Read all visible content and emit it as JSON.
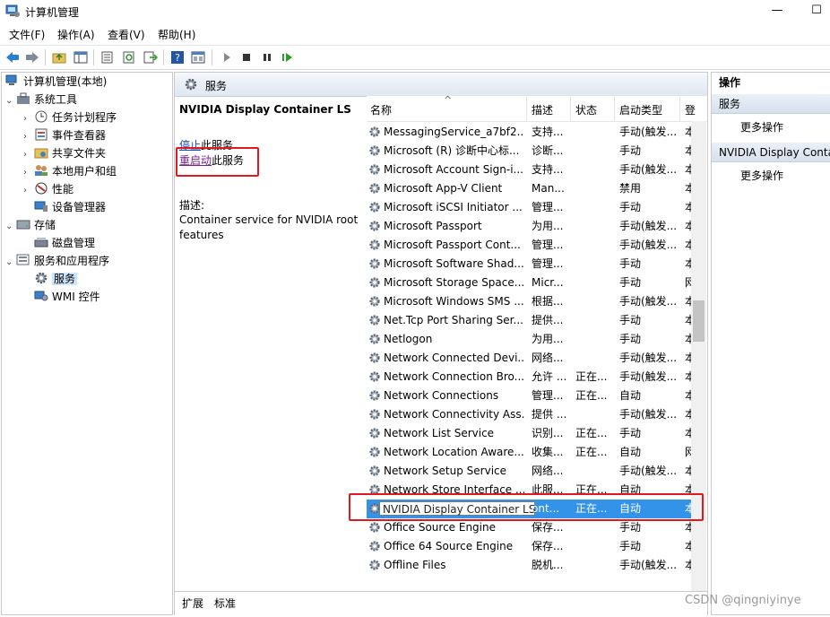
{
  "window": {
    "title": "计算机管理",
    "minimize_glyph": "—",
    "maximize_glyph": "☐"
  },
  "menu": [
    "文件(F)",
    "操作(A)",
    "查看(V)",
    "帮助(H)"
  ],
  "toolbar_icons": [
    "back-icon",
    "forward-icon",
    "up-folder-icon",
    "show-tree-icon",
    "properties-icon",
    "refresh-icon",
    "export-icon",
    "help-icon",
    "console-icon",
    "play-icon",
    "stop-icon",
    "pause-icon",
    "resume-icon"
  ],
  "tree": {
    "root": "计算机管理(本地)",
    "items": [
      {
        "label": "系统工具",
        "level": 1,
        "expand": "⌄"
      },
      {
        "label": "任务计划程序",
        "level": 2,
        "expand": "›"
      },
      {
        "label": "事件查看器",
        "level": 2,
        "expand": "›"
      },
      {
        "label": "共享文件夹",
        "level": 2,
        "expand": "›"
      },
      {
        "label": "本地用户和组",
        "level": 2,
        "expand": "›"
      },
      {
        "label": "性能",
        "level": 2,
        "expand": "›"
      },
      {
        "label": "设备管理器",
        "level": 2,
        "expand": ""
      },
      {
        "label": "存储",
        "level": 1,
        "expand": "⌄"
      },
      {
        "label": "磁盘管理",
        "level": 2,
        "expand": ""
      },
      {
        "label": "服务和应用程序",
        "level": 1,
        "expand": "⌄"
      },
      {
        "label": "服务",
        "level": 2,
        "expand": "",
        "selected": true
      },
      {
        "label": "WMI 控件",
        "level": 2,
        "expand": ""
      }
    ]
  },
  "middle": {
    "header": "服务",
    "selected_service": "NVIDIA Display Container LS",
    "stop_link": "停止",
    "stop_suffix": "此服务",
    "restart_link": "重启动",
    "restart_suffix": "此服务",
    "desc_label": "描述:",
    "desc_text": "Container service for NVIDIA root features",
    "columns": [
      "名称",
      "描述",
      "状态",
      "启动类型",
      "登"
    ],
    "sort_glyph": "^",
    "rows": [
      {
        "name": "MessagingService_a7bf2...",
        "desc": "支持...",
        "status": "",
        "startup": "手动(触发...",
        "logon": "本"
      },
      {
        "name": "Microsoft (R) 诊断中心标...",
        "desc": "诊断...",
        "status": "",
        "startup": "手动",
        "logon": "本"
      },
      {
        "name": "Microsoft Account Sign-i...",
        "desc": "支持...",
        "status": "",
        "startup": "手动(触发...",
        "logon": "本"
      },
      {
        "name": "Microsoft App-V Client",
        "desc": "Man...",
        "status": "",
        "startup": "禁用",
        "logon": "本"
      },
      {
        "name": "Microsoft iSCSI Initiator ...",
        "desc": "管理...",
        "status": "",
        "startup": "手动",
        "logon": "本"
      },
      {
        "name": "Microsoft Passport",
        "desc": "为用...",
        "status": "",
        "startup": "手动(触发...",
        "logon": "本"
      },
      {
        "name": "Microsoft Passport Cont...",
        "desc": "管理...",
        "status": "",
        "startup": "手动(触发...",
        "logon": "本"
      },
      {
        "name": "Microsoft Software Shad...",
        "desc": "管理...",
        "status": "",
        "startup": "手动",
        "logon": "本"
      },
      {
        "name": "Microsoft Storage Space...",
        "desc": "Micr...",
        "status": "",
        "startup": "手动",
        "logon": "网"
      },
      {
        "name": "Microsoft Windows SMS ...",
        "desc": "根据...",
        "status": "",
        "startup": "手动(触发...",
        "logon": "本"
      },
      {
        "name": "Net.Tcp Port Sharing Ser...",
        "desc": "提供...",
        "status": "",
        "startup": "手动",
        "logon": "本"
      },
      {
        "name": "Netlogon",
        "desc": "为用...",
        "status": "",
        "startup": "手动",
        "logon": "本"
      },
      {
        "name": "Network Connected Devi...",
        "desc": "网络...",
        "status": "",
        "startup": "手动(触发...",
        "logon": "本"
      },
      {
        "name": "Network Connection Bro...",
        "desc": "允许 ...",
        "status": "正在...",
        "startup": "手动(触发...",
        "logon": "本"
      },
      {
        "name": "Network Connections",
        "desc": "管理...",
        "status": "正在...",
        "startup": "自动",
        "logon": "本"
      },
      {
        "name": "Network Connectivity Ass...",
        "desc": "提供 ...",
        "status": "",
        "startup": "手动(触发...",
        "logon": "本"
      },
      {
        "name": "Network List Service",
        "desc": "识别...",
        "status": "正在...",
        "startup": "手动",
        "logon": "本"
      },
      {
        "name": "Network Location Aware...",
        "desc": "收集...",
        "status": "正在...",
        "startup": "自动",
        "logon": "网"
      },
      {
        "name": "Network Setup Service",
        "desc": "网络...",
        "status": "",
        "startup": "手动(触发...",
        "logon": "本"
      },
      {
        "name": "Network Store Interface ...",
        "desc": "此服...",
        "status": "正在...",
        "startup": "自动",
        "logon": "本"
      },
      {
        "name": "NVIDIA Display Container LS",
        "desc": "ont...",
        "status": "正在...",
        "startup": "自动",
        "logon": "本",
        "selected": true
      },
      {
        "name": "Office  Source Engine",
        "desc": "保存...",
        "status": "",
        "startup": "手动",
        "logon": "本"
      },
      {
        "name": "Office 64 Source Engine",
        "desc": "保存...",
        "status": "",
        "startup": "手动",
        "logon": "本"
      },
      {
        "name": "Offline Files",
        "desc": "脱机...",
        "status": "",
        "startup": "手动(触发...",
        "logon": "本"
      }
    ],
    "tabs": [
      "扩展",
      "标准"
    ]
  },
  "actions": {
    "title": "操作",
    "section1": "服务",
    "section1_more": "更多操作",
    "section2": "NVIDIA Display Container LS",
    "section2_more": "更多操作"
  },
  "watermark": "CSDN @qingniyinye",
  "colors": {
    "selection": "#3393e8",
    "highlight_box": "#e0191f",
    "link": "#1b4bb5"
  }
}
